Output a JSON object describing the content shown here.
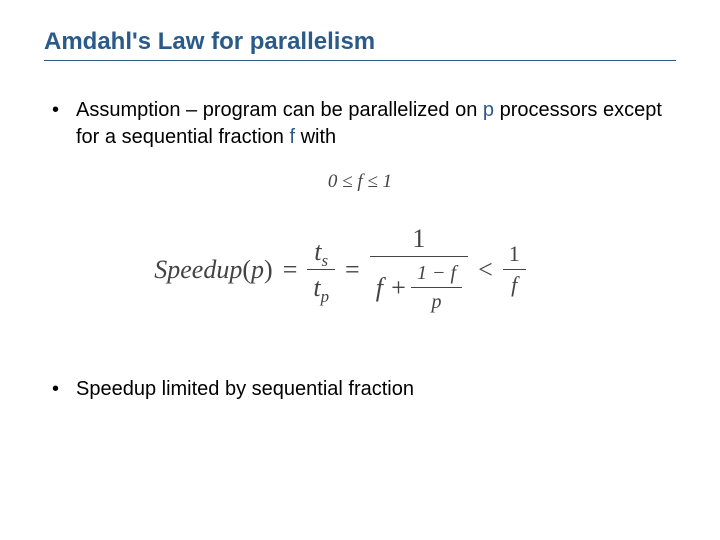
{
  "title": "Amdahl's Law for parallelism",
  "bullets": [
    {
      "prefix": "Assumption – program can be parallelized on ",
      "var1": "p",
      "mid": " processors except for a sequential fraction ",
      "var2": "f",
      "suffix": " with"
    },
    {
      "text": "Speedup limited by sequential fraction"
    }
  ],
  "formula_small": "0 ≤ f ≤ 1",
  "formula_main": {
    "lhs": "Speedup",
    "lhs_arg": "p",
    "eq": "=",
    "frac1": {
      "num_sym": "t",
      "num_sub": "s",
      "den_sym": "t",
      "den_sub": "p"
    },
    "frac2": {
      "num": "1",
      "den_left": "f +",
      "den_inner_num": "1 − f",
      "den_inner_den": "p"
    },
    "lt": "<",
    "frac3": {
      "num": "1",
      "den": "f"
    }
  }
}
